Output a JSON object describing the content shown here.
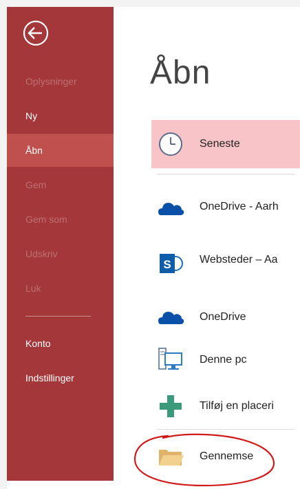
{
  "sidebar": {
    "back_label": "Tilbage",
    "items": [
      {
        "label": "Oplysninger",
        "state": "disabled"
      },
      {
        "label": "Ny",
        "state": "normal"
      },
      {
        "label": "Åbn",
        "state": "selected"
      },
      {
        "label": "Gem",
        "state": "disabled"
      },
      {
        "label": "Gem som",
        "state": "disabled"
      },
      {
        "label": "Udskriv",
        "state": "disabled"
      },
      {
        "label": "Luk",
        "state": "disabled"
      },
      {
        "label": "Konto",
        "state": "normal"
      },
      {
        "label": "Indstillinger",
        "state": "normal"
      }
    ]
  },
  "main": {
    "title": "Åbn",
    "locations": [
      {
        "label": "Seneste",
        "icon": "clock-icon",
        "selected": true
      },
      {
        "label": "OneDrive - Aarh",
        "icon": "onedrive-icon"
      },
      {
        "label": "Websteder – Aa",
        "icon": "sharepoint-icon"
      },
      {
        "label": "OneDrive",
        "icon": "onedrive-icon"
      },
      {
        "label": "Denne pc",
        "icon": "computer-icon"
      },
      {
        "label": "Tilføj en placeri",
        "icon": "plus-icon"
      },
      {
        "label": "Gennemse",
        "icon": "folder-icon"
      }
    ]
  },
  "colors": {
    "sidebar": "#a4373a",
    "sidebar_selected": "#c0504d",
    "location_selected": "#f8c4c7",
    "annotation": "#d11a1a"
  }
}
